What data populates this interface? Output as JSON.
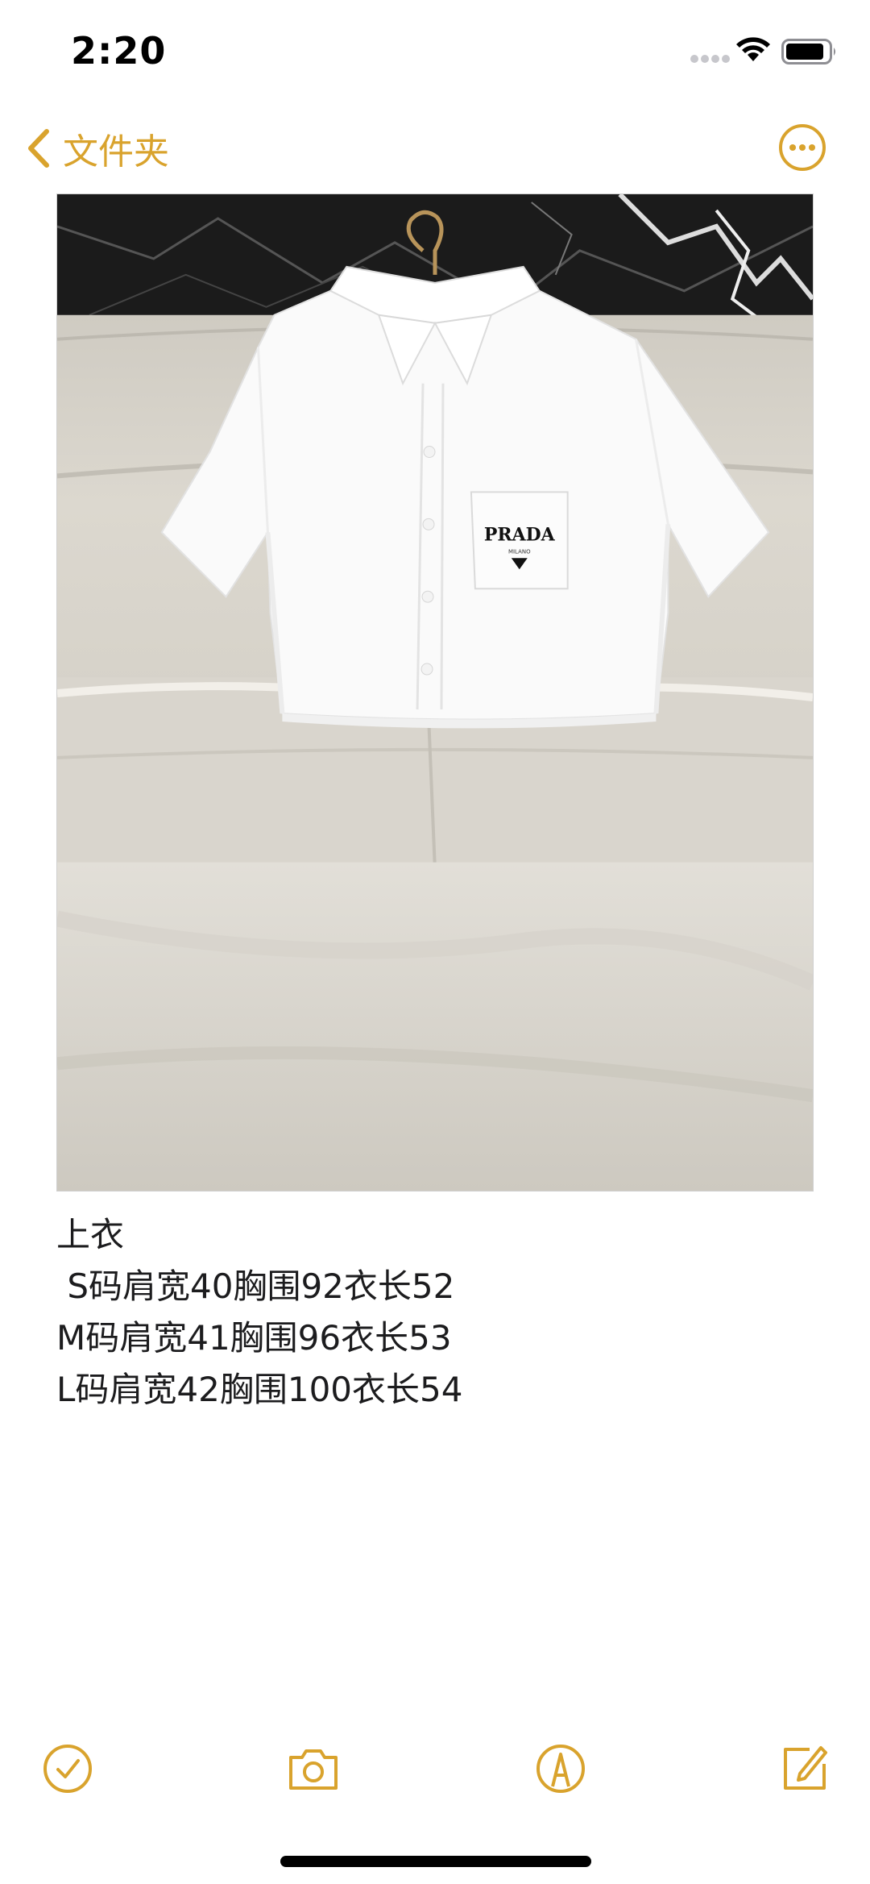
{
  "status_bar": {
    "time": "2:20",
    "signal_icon": "signal-dots-icon",
    "wifi_icon": "wifi-icon",
    "battery_icon": "battery-icon",
    "battery_level": 0.8
  },
  "nav": {
    "back_label": "文件夹",
    "back_icon": "chevron-left-icon",
    "more_icon": "ellipsis-circle-icon"
  },
  "photo": {
    "subject": "white cropped short-sleeve shirt on wooden hanger",
    "pocket_logo": "PRADA",
    "pocket_logo_sub": "MILANO"
  },
  "note": {
    "lines": [
      "上衣",
      " S码肩宽40胸围92衣长52",
      "M码肩宽41胸围96衣长53",
      "L码肩宽42胸围100衣长54"
    ]
  },
  "toolbar": {
    "checklist_icon": "checklist-icon",
    "camera_icon": "camera-icon",
    "markup_icon": "markup-pen-icon",
    "compose_icon": "compose-icon"
  },
  "colors": {
    "accent": "#d9a32d",
    "text": "#1c1c1e",
    "background": "#ffffff"
  }
}
